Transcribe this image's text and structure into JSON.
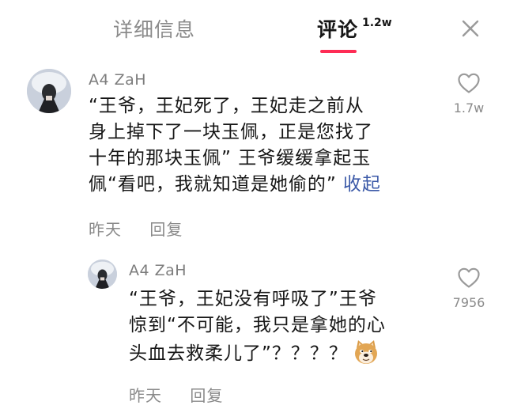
{
  "tabs": {
    "info_label": "详细信息",
    "comments_label": "评论",
    "comments_count": "1.2w",
    "close_icon": "close-icon"
  },
  "comments": [
    {
      "username": "A4 ZaH",
      "avatar_icon": "avatar",
      "text_lines": [
        "“王爷，王妃死了，王妃走之前从",
        "身上掉下了一块玉佩，正是您找了",
        "十年的那块玉佩” 王爷缓缓拿起玉",
        "佩“看吧，我就知道是她偷的”"
      ],
      "collapse_label": "收起",
      "date": "昨天",
      "reply_label": "回复",
      "like_icon": "heart-outline-icon",
      "like_count": "1.7w"
    },
    {
      "username": "A4 ZaH",
      "avatar_icon": "avatar",
      "text_lines": [
        "“王爷，王妃没有呼吸了”王爷",
        "惊到“不可能，我只是拿她的心",
        "头血去救柔儿了”？？？？"
      ],
      "emoji_icon": "doge-emoji-icon",
      "date": "昨天",
      "reply_label": "回复",
      "like_icon": "heart-outline-icon",
      "like_count": "7956"
    }
  ],
  "colors": {
    "accent": "#fe2c55",
    "link": "#3c5aa8",
    "text": "#161616",
    "muted": "#8a8a8a"
  }
}
